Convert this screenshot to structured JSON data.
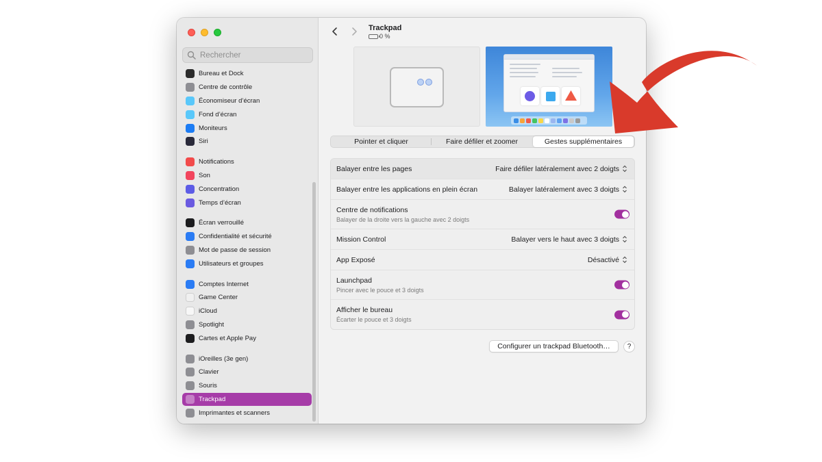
{
  "search": {
    "placeholder": "Rechercher"
  },
  "sidebar": {
    "items": [
      {
        "label": "Bureau et Dock",
        "icon": "dock-icon",
        "color": "#2b2b2b"
      },
      {
        "label": "Centre de contrôle",
        "icon": "control-center-icon",
        "color": "#8e8e93"
      },
      {
        "label": "Économiseur d’écran",
        "icon": "screensaver-icon",
        "color": "#5ac8fa"
      },
      {
        "label": "Fond d’écran",
        "icon": "wallpaper-icon",
        "color": "#5ac8fa"
      },
      {
        "label": "Moniteurs",
        "icon": "displays-icon",
        "color": "#1c7cf4"
      },
      {
        "label": "Siri",
        "icon": "siri-icon",
        "color": "#2a2a3a"
      },
      {
        "label": "Notifications",
        "icon": "notifications-icon",
        "color": "#f24b4b"
      },
      {
        "label": "Son",
        "icon": "sound-icon",
        "color": "#f2455d"
      },
      {
        "label": "Concentration",
        "icon": "focus-icon",
        "color": "#5d5ce6"
      },
      {
        "label": "Temps d’écran",
        "icon": "screen-time-icon",
        "color": "#6a5ae0"
      },
      {
        "label": "Écran verrouillé",
        "icon": "lock-screen-icon",
        "color": "#1d1d1f"
      },
      {
        "label": "Confidentialité et sécurité",
        "icon": "privacy-icon",
        "color": "#2b7cf4"
      },
      {
        "label": "Mot de passe de session",
        "icon": "password-icon",
        "color": "#8e8e93"
      },
      {
        "label": "Utilisateurs et groupes",
        "icon": "users-icon",
        "color": "#2b7cf4"
      },
      {
        "label": "Comptes Internet",
        "icon": "internet-accounts-icon",
        "color": "#2b7cf4"
      },
      {
        "label": "Game Center",
        "icon": "game-center-icon",
        "color": "#f0f0f0"
      },
      {
        "label": "iCloud",
        "icon": "icloud-icon",
        "color": "#f7f7f7"
      },
      {
        "label": "Spotlight",
        "icon": "spotlight-icon",
        "color": "#8e8e93"
      },
      {
        "label": "Cartes et Apple Pay",
        "icon": "wallet-icon",
        "color": "#1d1d1f"
      },
      {
        "label": "iOreilles (3e gen)",
        "icon": "airpods-icon",
        "color": "#8e8e93"
      },
      {
        "label": "Clavier",
        "icon": "keyboard-icon",
        "color": "#8e8e93"
      },
      {
        "label": "Souris",
        "icon": "mouse-icon",
        "color": "#8e8e93"
      },
      {
        "label": "Trackpad",
        "icon": "trackpad-icon",
        "color": "#8e8e93",
        "selected": true
      },
      {
        "label": "Imprimantes et scanners",
        "icon": "printer-icon",
        "color": "#8e8e93"
      }
    ]
  },
  "header": {
    "title": "Trackpad",
    "battery": "0 %"
  },
  "tabs": [
    "Pointer et cliquer",
    "Faire défiler et zoomer",
    "Gestes supplémentaires"
  ],
  "rows": [
    {
      "label": "Balayer entre les pages",
      "value": "Faire défiler latéralement avec 2 doigts"
    },
    {
      "label": "Balayer entre les applications en plein écran",
      "value": "Balayer latéralement avec 3 doigts"
    },
    {
      "label": "Centre de notifications",
      "sub": "Balayer de la droite vers la gauche avec 2 doigts",
      "toggle": true
    },
    {
      "label": "Mission Control",
      "value": "Balayer vers le haut avec 3 doigts"
    },
    {
      "label": "App Exposé",
      "value": "Désactivé"
    },
    {
      "label": "Launchpad",
      "sub": "Pincer avec le pouce et 3 doigts",
      "toggle": true
    },
    {
      "label": "Afficher le bureau",
      "sub": "Écarter le pouce et 3 doigts",
      "toggle": true
    }
  ],
  "footer": {
    "bluetooth_button": "Configurer un trackpad Bluetooth…",
    "help": "?"
  },
  "colors": {
    "accent": "#a63ca8",
    "toggle_on": "#a2309f",
    "arrow": "#d93a2b"
  }
}
